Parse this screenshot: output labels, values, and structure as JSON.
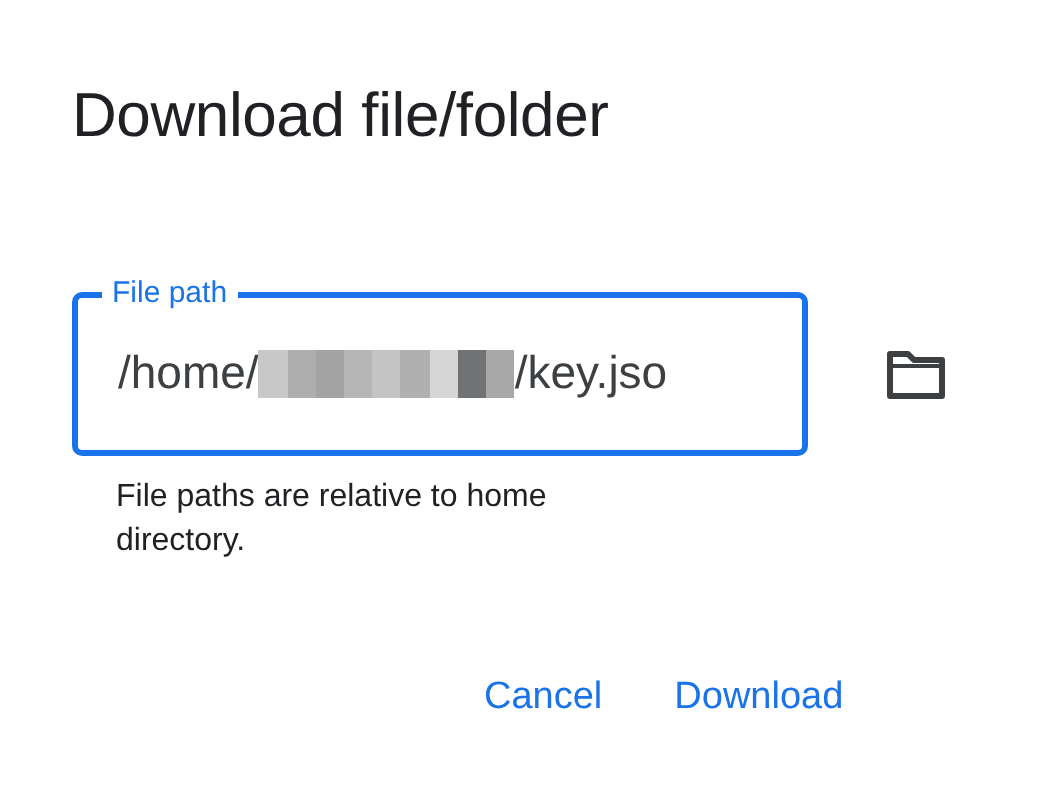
{
  "dialog": {
    "title": "Download file/folder",
    "field": {
      "label": "File path",
      "value_start": "/home/",
      "redacted": true,
      "value_end": "/key.jso",
      "focused": true
    },
    "helper": "File paths are relative to home directory.",
    "buttons": [
      "Cancel",
      "Download"
    ]
  }
}
